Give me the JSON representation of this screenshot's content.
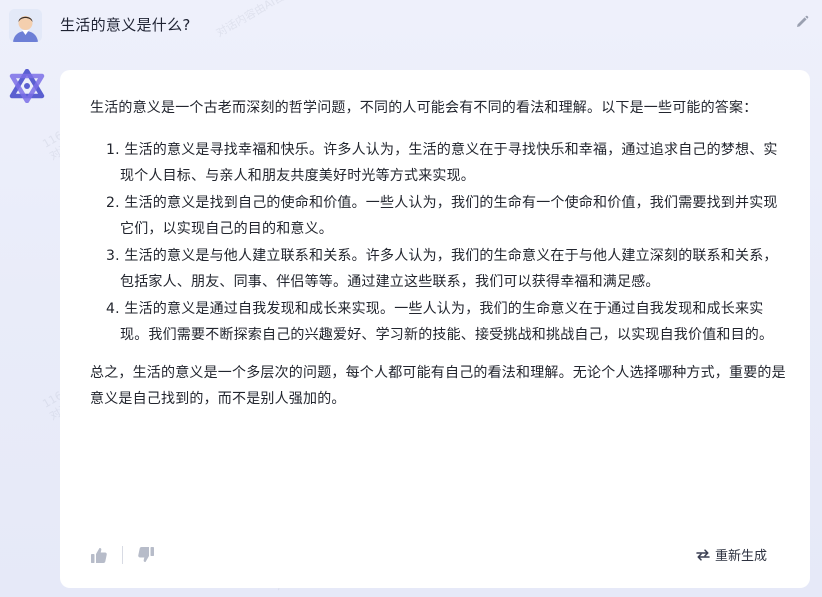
{
  "user_message": {
    "text": "生活的意义是什么?"
  },
  "answer": {
    "intro": "生活的意义是一个古老而深刻的哲学问题，不同的人可能会有不同的看法和理解。以下是一些可能的答案：",
    "items": [
      "1. 生活的意义是寻找幸福和快乐。许多人认为，生活的意义在于寻找快乐和幸福，通过追求自己的梦想、实现个人目标、与亲人和朋友共度美好时光等方式来实现。",
      "2. 生活的意义是找到自己的使命和价值。一些人认为，我们的生命有一个使命和价值，我们需要找到并实现它们，以实现自己的目的和意义。",
      "3. 生活的意义是与他人建立联系和关系。许多人认为，我们的生命意义在于与他人建立深刻的联系和关系，包括家人、朋友、同事、伴侣等等。通过建立这些联系，我们可以获得幸福和满足感。",
      "4. 生活的意义是通过自我发现和成长来实现。一些人认为，我们的生命意义在于通过自我发现和成长来实现。我们需要不断探索自己的兴趣爱好、学习新的技能、接受挑战和挑战自己，以实现自我价值和目的。"
    ],
    "summary": "总之，生活的意义是一个多层次的问题，每个人都可能有自己的看法和理解。无论个人选择哪种方式，重要的是意义是自己找到的，而不是别人强加的。"
  },
  "actions": {
    "regenerate_label": "重新生成"
  },
  "watermark": {
    "id": "116848087577316",
    "text": "对话内容由AI自动生成"
  },
  "icons": {
    "edit": "pencil-icon",
    "like": "thumbs-up-icon",
    "dislike": "thumbs-down-icon",
    "regenerate": "refresh-icon",
    "bot": "bot-logo-icon",
    "user": "user-avatar"
  }
}
